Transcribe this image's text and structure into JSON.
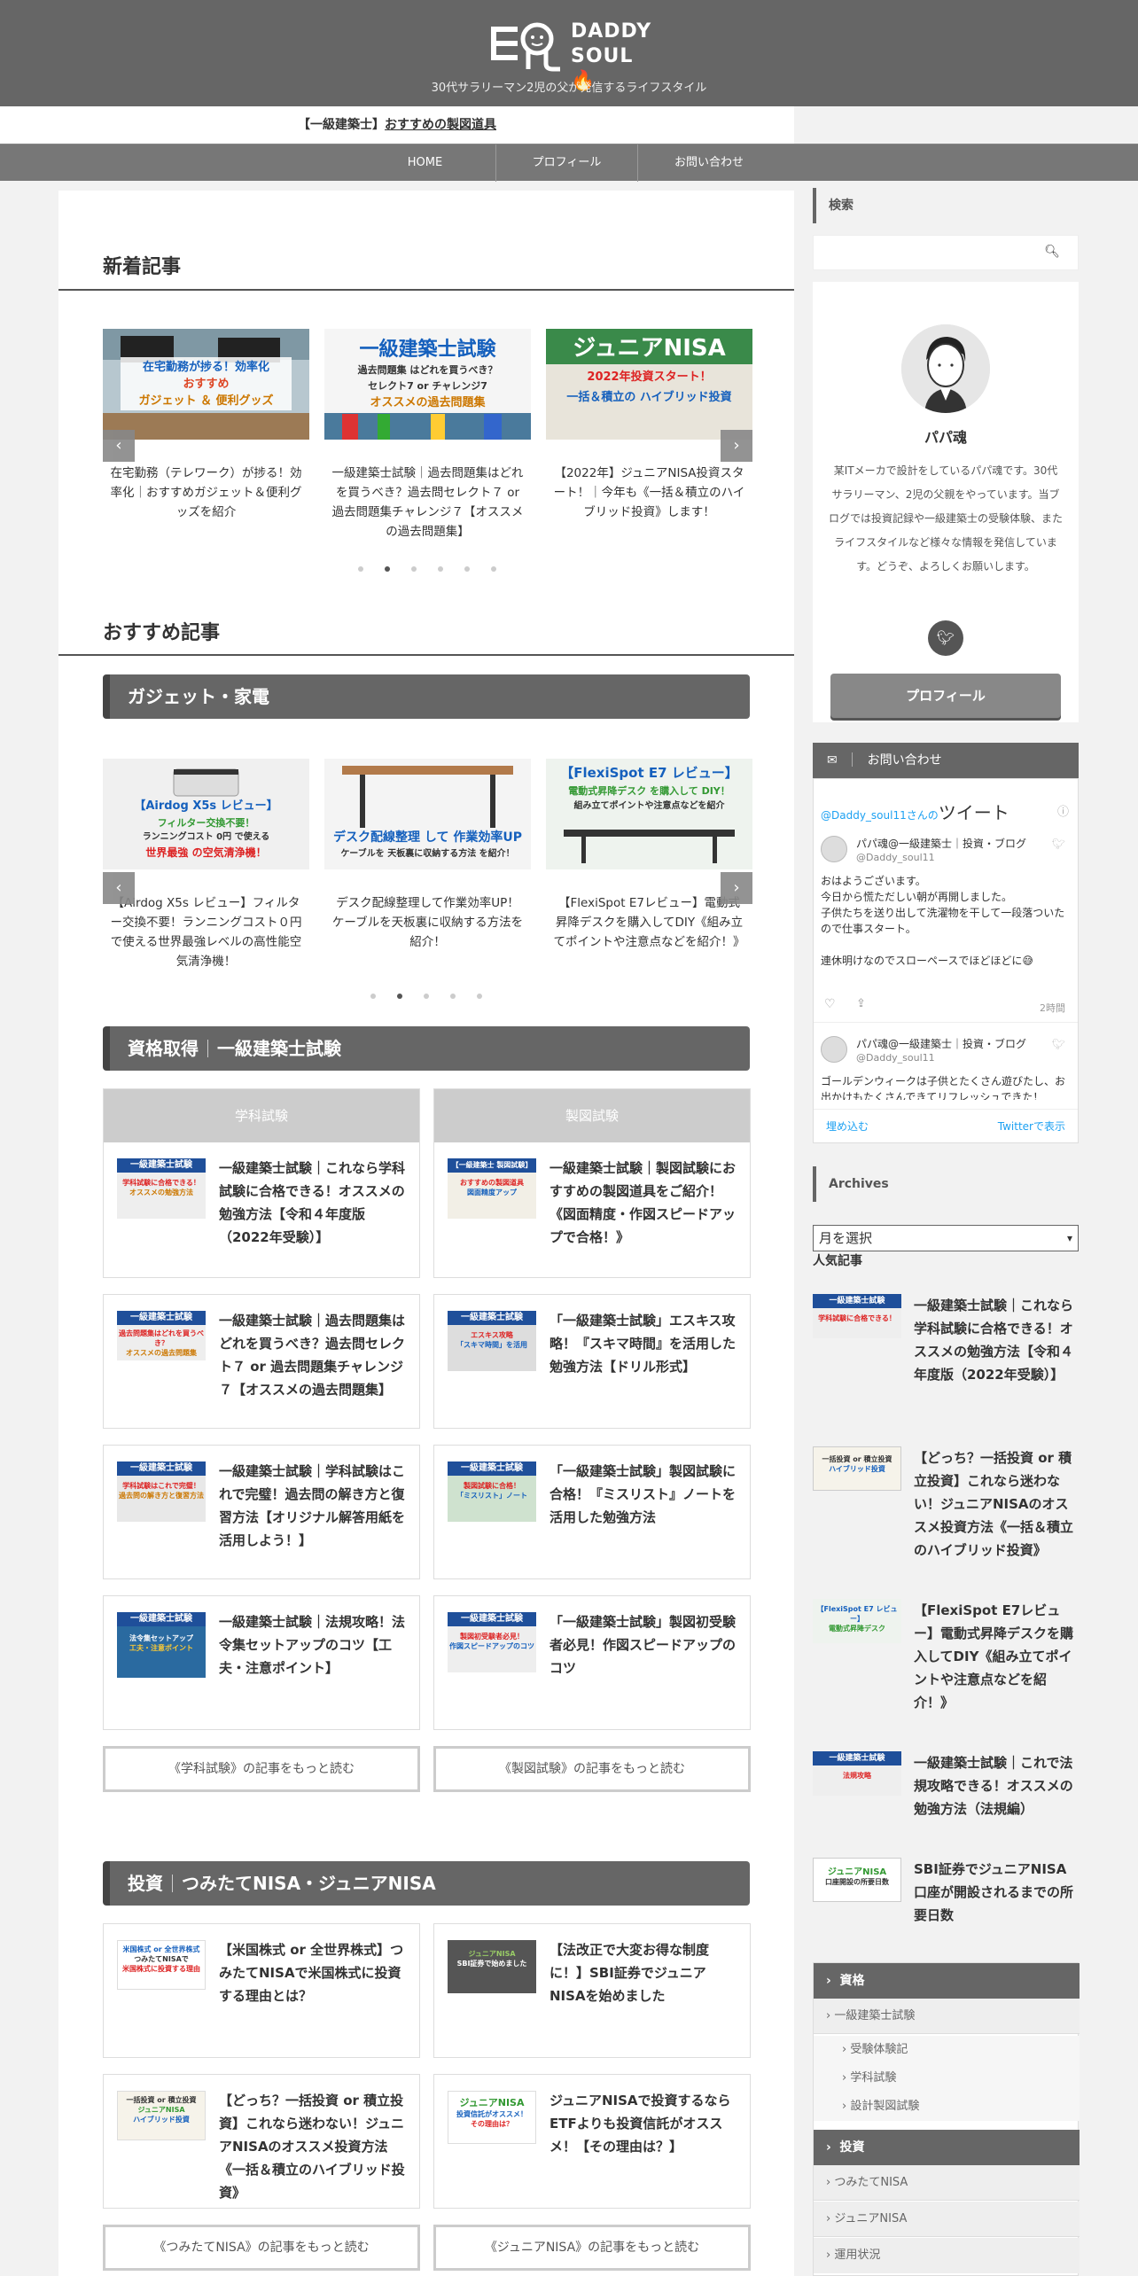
{
  "header": {
    "logo_word_1": "DADDY",
    "logo_word_2": "SOUL",
    "tagline": "30代サラリーマン2児の父が発信するライフスタイル"
  },
  "notice": {
    "prefix": "【一級建築士】",
    "link": "おすすめの製図道具"
  },
  "nav": [
    "HOME",
    "プロフィール",
    "お問い合わせ"
  ],
  "new_posts": {
    "title": "新着記事",
    "slides": [
      {
        "caption": "在宅勤務（テレワーク）が捗る！効率化｜おすすめガジェット＆便利グッズを紹介",
        "thumb_lines": [
          "在宅勤務が捗る！効率化",
          "おすすめ",
          "ガジェット ＆ 便利グッズ"
        ]
      },
      {
        "caption": "一級建築士試験｜過去問題集はどれを買うべき？過去問セレクト７ or 過去問題集チャレンジ７【オススメの過去問題集】",
        "thumb_lines": [
          "一級建築士試験",
          "過去問題集 はどれを買うべき？",
          "セレクト7 or チャレンジ7",
          "オススメの過去問題集"
        ]
      },
      {
        "caption": "【2022年】ジュニアNISA投資スタート！｜今年も《一括＆積立のハイブリッド投資》します！",
        "thumb_lines": [
          "ジュニアNISA",
          "2022年投資スタート！",
          "一括＆積立の ハイブリッド投資"
        ]
      }
    ],
    "dots": 6,
    "active_dot": 1
  },
  "recommended": {
    "title": "おすすめ記事",
    "gadget": {
      "title": "ガジェット・家電",
      "slides": [
        {
          "caption": "【Airdog X5s レビュー】フィルター交換不要！ランニングコスト０円で使える世界最強レベルの高性能空気清浄機！",
          "thumb_lines": [
            "【Airdog X5s レビュー】",
            "フィルター交換不要！",
            "ランニングコスト 0円 で使える",
            "世界最強 の空気清浄機！"
          ]
        },
        {
          "caption": "デスク配線整理して作業効率UP！ケーブルを天板裏に収納する方法を紹介！",
          "thumb_lines": [
            "デスク配線整理 して 作業効率UP",
            "ケーブルを 天板裏に収納する方法 を紹介！"
          ]
        },
        {
          "caption": "【FlexiSpot E7レビュー】電動式昇降デスクを購入してDIY《組み立てポイントや注意点などを紹介！》",
          "thumb_lines": [
            "【FlexiSpot E7 レビュー】",
            "電動式昇降デスク を購入して DIY！",
            "組み立てポイントや注意点などを紹介"
          ]
        }
      ],
      "dots": 5,
      "active_dot": 1
    }
  },
  "kenchikushi": {
    "title_a": "資格取得",
    "title_b": "一級建築士試験",
    "col_heads": [
      "学科試験",
      "製図試験"
    ],
    "items_left": [
      {
        "title": "一級建築士試験｜これなら学科試験に合格できる！オススメの勉強方法【令和４年度版（2022年受験）】",
        "thumb": [
          "一級建築士試験",
          "学科試験に合格できる！",
          "オススメの勉強方法"
        ]
      },
      {
        "title": "一級建築士試験｜過去問題集はどれを買うべき？過去問セレクト７ or 過去問題集チャレンジ７【オススメの過去問題集】",
        "thumb": [
          "一級建築士試験",
          "過去問題集はどれを買うべき？",
          "オススメの過去問題集"
        ]
      },
      {
        "title": "一級建築士試験｜学科試験はこれで完璧！過去問の解き方と復習方法【オリジナル解答用紙を活用しよう！】",
        "thumb": [
          "一級建築士試験",
          "学科試験はこれで完璧！",
          "過去問の解き方と復習方法"
        ]
      },
      {
        "title": "一級建築士試験｜法規攻略！法令集セットアップのコツ【工夫・注意ポイント】",
        "thumb": [
          "一級建築士試験",
          "法令集セットアップ",
          "工夫・注意ポイント"
        ]
      }
    ],
    "items_right": [
      {
        "title": "一級建築士試験｜製図試験におすすめの製図道具をご紹介！《図面精度・作図スピードアップで合格！》",
        "thumb": [
          "【一級建築士 製図試験】",
          "おすすめの製図道具",
          "図面精度アップ"
        ]
      },
      {
        "title": "「一級建築士試験」エスキス攻略！『スキマ時間』を活用した勉強方法【ドリル形式】",
        "thumb": [
          "一級建築士試験",
          "エスキス攻略",
          "「スキマ時間」を活用"
        ]
      },
      {
        "title": "「一級建築士試験」製図試験に合格！『ミスリスト』ノートを活用した勉強方法",
        "thumb": [
          "一級建築士試験",
          "製図試験に合格！",
          "「ミスリスト」ノート"
        ]
      },
      {
        "title": "「一級建築士試験」製図初受験者必見！作図スピードアップのコツ",
        "thumb": [
          "一級建築士試験",
          "製図初受験者必見！",
          "作図スピードアップのコツ"
        ]
      }
    ],
    "more_left": "《学科試験》の記事をもっと読む",
    "more_right": "《製図試験》の記事をもっと読む"
  },
  "nisa": {
    "title_a": "投資",
    "title_b": "つみたてNISA・ジュニアNISA",
    "items_left": [
      {
        "title": "【米国株式 or 全世界株式】つみたてNISAで米国株式に投資する理由とは？",
        "thumb": [
          "米国株式 or 全世界株式",
          "つみたてNISAで",
          "米国株式に投資する理由"
        ]
      },
      {
        "title": "【どっち？一括投資 or 積立投資】これなら迷わない！ジュニアNISAのオススメ投資方法《一括＆積立のハイブリッド投資》",
        "thumb": [
          "一括投資 or 積立投資",
          "ジュニアNISA",
          "ハイブリッド投資"
        ]
      }
    ],
    "items_right": [
      {
        "title": "【法改正で大変お得な制度に！】SBI証券でジュニアNISAを始めました",
        "thumb": [
          "ジュニアNISA",
          "SBI証券で始めました"
        ]
      },
      {
        "title": "ジュニアNISAで投資するならETFよりも投資信託がオススメ！【その理由は？】",
        "thumb": [
          "ジュニアNISA",
          "投資信託がオススメ！",
          "その理由は？"
        ]
      }
    ],
    "more_left": "《つみたてNISA》の記事をもっと読む",
    "more_right": "《ジュニアNISA》の記事をもっと読む"
  },
  "sidebar": {
    "search_label": "検索",
    "profile": {
      "name": "パパ魂",
      "bio": "某ITメーカで設計をしているパパ魂です。30代サラリーマン、2児の父親をやっています。当ブログでは投資記録や一級建築士の受験体験、またライフスタイルなど様々な情報を発信しています。どうぞ、よろしくお願いします。",
      "button": "プロフィール"
    },
    "contact_label": "お問い合わせ",
    "twitter": {
      "handle_prefix": "@Daddy_soul11さんの",
      "heading": "ツイート",
      "tweets": [
        {
          "name": "パパ魂@一級建築士｜投資・ブログ",
          "handle": "@Daddy_soul11",
          "body": "おはようございます。\n今日から慌ただしい朝が再開しました。\n子供たちを送り出して洗濯物を干して一段落ついたので仕事スタート。\n\n連休明けなのでスローペースでほどほどに😅",
          "time": "2時間"
        },
        {
          "name": "パパ魂@一級建築士｜投資・ブログ",
          "handle": "@Daddy_soul11",
          "body": "ゴールデンウィークは子供とたくさん遊びたし、お出かけもたくさんできてリフレッシュできた！"
        }
      ],
      "embed": "埋め込む",
      "view": "Twitterで表示"
    },
    "archives_label": "Archives",
    "archives_select": "月を選択",
    "popular_label": "人気記事",
    "popular": [
      {
        "title": "一級建築士試験｜これなら学科試験に合格できる！オススメの勉強方法【令和４年度版（2022年受験）】",
        "thumb": [
          "一級建築士試験",
          "学科試験に合格できる！"
        ]
      },
      {
        "title": "【どっち？一括投資 or 積立投資】これなら迷わない！ジュニアNISAのオススメ投資方法《一括＆積立のハイブリッド投資》",
        "thumb": [
          "一括投資 or 積立投資",
          "ハイブリッド投資"
        ]
      },
      {
        "title": "【FlexiSpot E7レビュー】電動式昇降デスクを購入してDIY《組み立てポイントや注意点などを紹介！》",
        "thumb": [
          "【FlexiSpot E7 レビュー】",
          "電動式昇降デスク"
        ]
      },
      {
        "title": "一級建築士試験｜これで法規攻略できる！オススメの勉強方法（法規編）",
        "thumb": [
          "一級建築士試験",
          "法規攻略"
        ]
      },
      {
        "title": "SBI証券でジュニアNISA口座が開設されるまでの所要日数",
        "thumb": [
          "ジュニアNISA",
          "口座開設の所要日数"
        ]
      }
    ],
    "categories": {
      "shikaku": "資格",
      "kenchikushi": "一級建築士試験",
      "sub": [
        "受験体験記",
        "学科試験",
        "設計製図試験"
      ],
      "toushi": "投資",
      "tsumitate": "つみたてNISA",
      "junior": "ジュニアNISA",
      "unyou": "運用状況"
    }
  },
  "colors": {
    "header_bg": "#666666",
    "accent_blue": "#1560bd",
    "twitter_blue": "#1da1f2"
  }
}
